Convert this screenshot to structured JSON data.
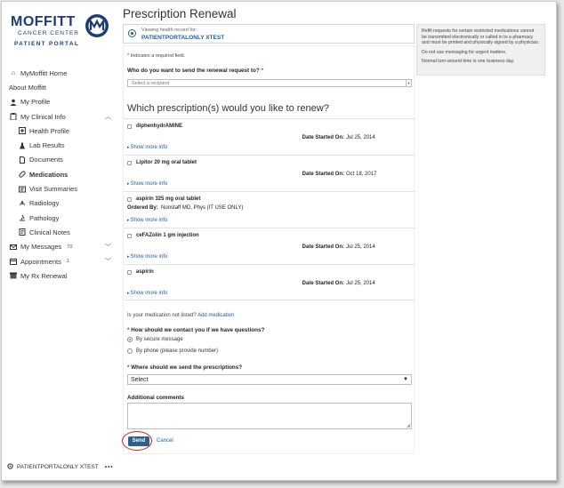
{
  "logo": {
    "main": "MOFFITT",
    "sub": "CANCER CENTER",
    "portal": "PATIENT PORTAL"
  },
  "nav": [
    {
      "label": "MyMoffitt Home",
      "icon": "home-icon"
    },
    {
      "label": "About Moffitt",
      "icon": ""
    },
    {
      "label": "My Profile",
      "icon": "user-icon"
    },
    {
      "label": "My Clinical Info",
      "icon": "clipboard-icon"
    },
    {
      "label": "Health Profile",
      "icon": "health-profile-icon"
    },
    {
      "label": "Lab Results",
      "icon": "lab-icon"
    },
    {
      "label": "Documents",
      "icon": "document-icon"
    },
    {
      "label": "Medications",
      "icon": "pill-icon"
    },
    {
      "label": "Visit Summaries",
      "icon": "visit-icon"
    },
    {
      "label": "Radiology",
      "icon": "radiology-icon"
    },
    {
      "label": "Pathology",
      "icon": "pathology-icon"
    },
    {
      "label": "Clinical Notes",
      "icon": "notes-icon"
    },
    {
      "label": "My Messages",
      "icon": "mail-icon",
      "badge": "70"
    },
    {
      "label": "Appointments",
      "icon": "calendar-icon",
      "badge": "1"
    },
    {
      "label": "My Rx Renewal",
      "icon": "rx-icon"
    }
  ],
  "user": {
    "name": "PATIENTPORTALONLY XTEST",
    "more": "•••"
  },
  "page_title": "Prescription Renewal",
  "record": {
    "viewing": "Viewing health record for:",
    "name": "PATIENTPORTALONLY XTEST"
  },
  "form": {
    "required_note": "* Indicates a required field.",
    "recipient_question": "Who do you want to send the renewal request to?",
    "recipient_placeholder": "Select a recipient",
    "section_title": "Which prescription(s) would you like to renew?",
    "date_label": "Date Started On:",
    "ordered_by_label": "Ordered By:",
    "show_more": "Show more info",
    "prescriptions": [
      {
        "name": "diphenhydrAMINE",
        "date": "Jul 25, 2014"
      },
      {
        "name": "Lipitor 20 mg oral tablet",
        "date": "Oct 18, 2017"
      },
      {
        "name": "aspirin 325 mg oral tablet",
        "date": "",
        "ordered_by": "Nonstaff MD, Phys (IT USE ONLY)"
      },
      {
        "name": "ceFAZolin 1 gm injection",
        "date": "Jul 25, 2014"
      },
      {
        "name": "aspirin",
        "date": "Jul 25, 2014"
      }
    ],
    "not_listed": "Is your medication not listed?",
    "add_medication": "Add medication",
    "contact_question": "How should we contact you if we have questions?",
    "contact_options": [
      "By secure message",
      "By phone (please provide number)"
    ],
    "send_question": "Where should we send the prescriptions?",
    "send_select": "Select",
    "comments_label": "Additional comments",
    "send_button": "Send",
    "cancel_button": "Cancel"
  },
  "info_panel": [
    "Refill requests for certain restricted medications cannot be transmitted electronically or called in to a pharmacy and must be printed and physically signed by a physician.",
    "Do not use messaging for urgent matters.",
    "Normal turn-around time is one business day."
  ],
  "colors": {
    "brand": "#1d3d74",
    "link": "#1d5d99",
    "button": "#2c5f93",
    "annotation": "#d21a1a"
  }
}
